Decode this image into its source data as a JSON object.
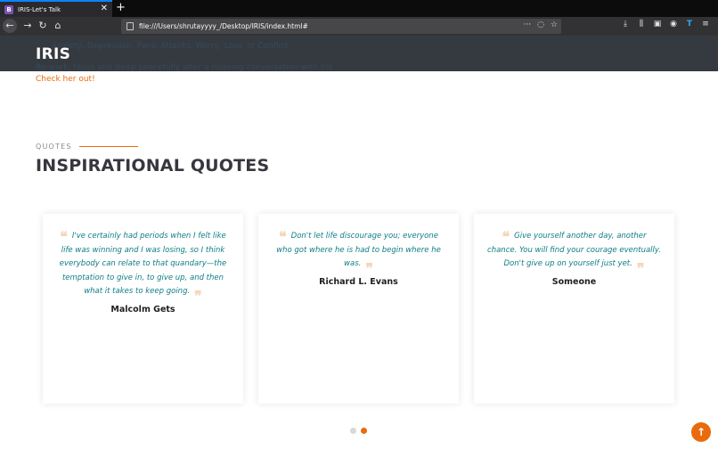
{
  "browser": {
    "tab_favicon_letter": "B",
    "tab_title": "IRIS-Let's Talk",
    "tab_close": "✕",
    "new_tab": "+",
    "back": "←",
    "forward": "→",
    "reload": "↻",
    "home": "⌂",
    "url": "file:///Users/shrutayyyy_/Desktop/IRIS/index.html#",
    "page_actions": "···",
    "pocket": "◌",
    "bookmark_star": "☆",
    "download": "⤓",
    "library": "⫼",
    "sidebar": "▣",
    "account": "◉",
    "extension": "T",
    "menu": "≡"
  },
  "site": {
    "brand": "IRIS",
    "hero_line1": "Anxiety, Depression, Panic Attacks, Worry, Loss, or Conflict",
    "hero_line2": "Re-work, focus and sleep peacefully after a relaxing conversation with Iris",
    "check_link": "Check her out!",
    "accent_color": "#e96b0c",
    "quote_color": "#0e7d84"
  },
  "quotes_section": {
    "label": "QUOTES",
    "title": "INSPIRATIONAL QUOTES",
    "open_mark": "❝",
    "close_mark": "❞",
    "items": [
      {
        "text": "I've certainly had periods when I felt like life was winning and I was losing, so I think everybody can relate to that quandary—the temptation to give in, to give up, and then what it takes to keep going.",
        "author": "Malcolm Gets"
      },
      {
        "text": "Don't let life discourage you; everyone who got where he is had to begin where he was.",
        "author": "Richard L. Evans"
      },
      {
        "text": "Give yourself another day, another chance. You will find your courage eventually. Don't give up on yourself just yet.",
        "author": "Someone"
      }
    ],
    "carousel_active_index": 1,
    "carousel_count": 2
  },
  "back_to_top": "↑"
}
